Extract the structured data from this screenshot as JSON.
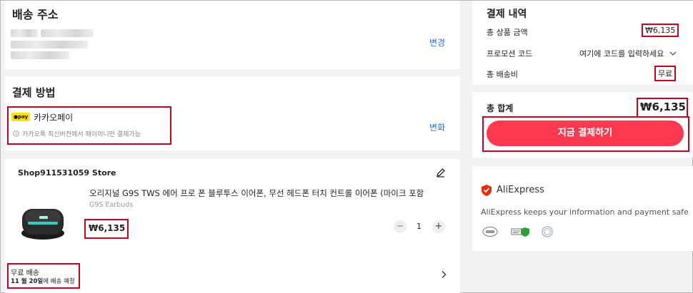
{
  "address": {
    "title": "배송 주소",
    "change": "변경"
  },
  "payment": {
    "title": "결제 방법",
    "method_logo": "●pay",
    "method_name": "카카오페이",
    "note": "카카오톡 최신버전에서 페이머니만 결제가능",
    "change": "변화"
  },
  "product": {
    "store": "Shop911531059 Store",
    "title": "오리지널 G9S TWS 에어 프로 폰 블루투스 이어폰, 무선 헤드폰 터치 컨트롤 이어폰 (마이크 포함",
    "subtitle": "G9S Earbuds",
    "price": "₩6,135",
    "quantity": "1",
    "minus": "−",
    "plus": "+",
    "shipping_label": "무료 배송",
    "delivery_date": "11 월 20일",
    "delivery_suffix": "에 배송 예정"
  },
  "summary": {
    "title": "결제 내역",
    "subtotal_label": "총 상품 금액",
    "subtotal_value": "₩6,135",
    "promo_label": "프로모션 코드",
    "promo_value": "여기에 코드를 입력하세요",
    "shipping_label": "총 배송비",
    "shipping_value": "무료",
    "total_label": "총 합계",
    "total_value": "₩6,135",
    "pay_button": "지금 결제하기"
  },
  "trust": {
    "brand": "AliExpress",
    "text": "AliExpress keeps your information and payment safe"
  },
  "colors": {
    "accent": "#fd384f",
    "link": "#2c6fd1",
    "highlight": "#d0021b"
  }
}
